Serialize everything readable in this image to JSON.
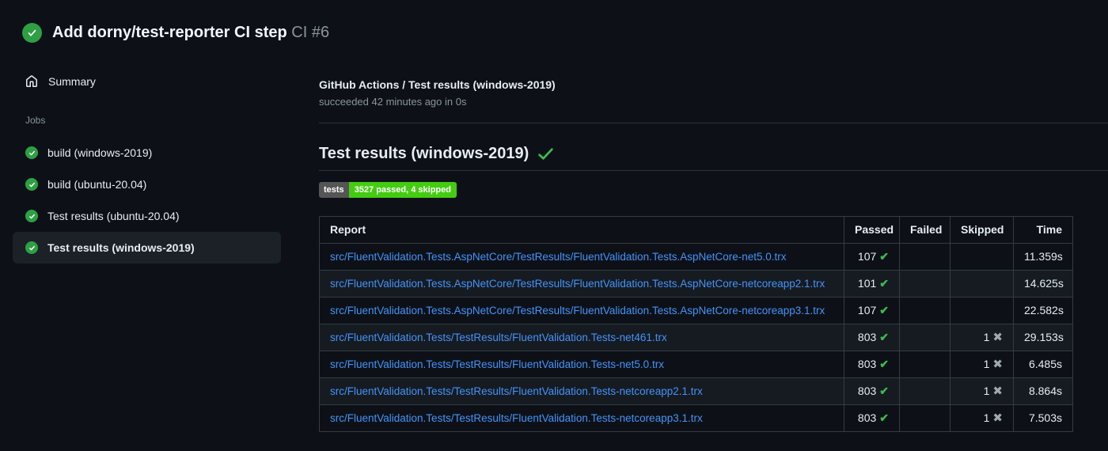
{
  "page": {
    "title": "Add dorny/test-reporter CI step",
    "run_number": "CI #6"
  },
  "sidebar": {
    "summary_label": "Summary",
    "jobs_heading": "Jobs",
    "jobs": [
      {
        "label": "build (windows-2019)",
        "selected": false
      },
      {
        "label": "build (ubuntu-20.04)",
        "selected": false
      },
      {
        "label": "Test results (ubuntu-20.04)",
        "selected": false
      },
      {
        "label": "Test results (windows-2019)",
        "selected": true
      }
    ]
  },
  "main": {
    "check_title": "GitHub Actions / Test results (windows-2019)",
    "check_status": "succeeded 42 minutes ago in 0s",
    "section_title": "Test results (windows-2019)",
    "badge": {
      "label": "tests",
      "value": "3527 passed, 4 skipped"
    },
    "table": {
      "columns": [
        "Report",
        "Passed",
        "Failed",
        "Skipped",
        "Time"
      ],
      "rows": [
        {
          "report": "src/FluentValidation.Tests.AspNetCore/TestResults/FluentValidation.Tests.AspNetCore-net5.0.trx",
          "passed": "107",
          "failed": "",
          "skipped": "",
          "time": "11.359s"
        },
        {
          "report": "src/FluentValidation.Tests.AspNetCore/TestResults/FluentValidation.Tests.AspNetCore-netcoreapp2.1.trx",
          "passed": "101",
          "failed": "",
          "skipped": "",
          "time": "14.625s"
        },
        {
          "report": "src/FluentValidation.Tests.AspNetCore/TestResults/FluentValidation.Tests.AspNetCore-netcoreapp3.1.trx",
          "passed": "107",
          "failed": "",
          "skipped": "",
          "time": "22.582s"
        },
        {
          "report": "src/FluentValidation.Tests/TestResults/FluentValidation.Tests-net461.trx",
          "passed": "803",
          "failed": "",
          "skipped": "1",
          "time": "29.153s"
        },
        {
          "report": "src/FluentValidation.Tests/TestResults/FluentValidation.Tests-net5.0.trx",
          "passed": "803",
          "failed": "",
          "skipped": "1",
          "time": "6.485s"
        },
        {
          "report": "src/FluentValidation.Tests/TestResults/FluentValidation.Tests-netcoreapp2.1.trx",
          "passed": "803",
          "failed": "",
          "skipped": "1",
          "time": "8.864s"
        },
        {
          "report": "src/FluentValidation.Tests/TestResults/FluentValidation.Tests-netcoreapp3.1.trx",
          "passed": "803",
          "failed": "",
          "skipped": "1",
          "time": "7.503s"
        }
      ]
    }
  },
  "icons": {
    "run_status": "check-circle-icon",
    "summary": "home-icon",
    "job_status": "check-circle-icon",
    "passed_mark": "check-icon",
    "skipped_mark": "x-icon"
  },
  "colors": {
    "background": "#0d1117",
    "row_alt": "#161b22",
    "success_green": "#2ea043",
    "check_green": "#3fb950",
    "link_blue": "#4493f8",
    "badge_label_bg": "#555555",
    "badge_value_bg": "#44cc11",
    "muted_text": "#8b949e"
  }
}
